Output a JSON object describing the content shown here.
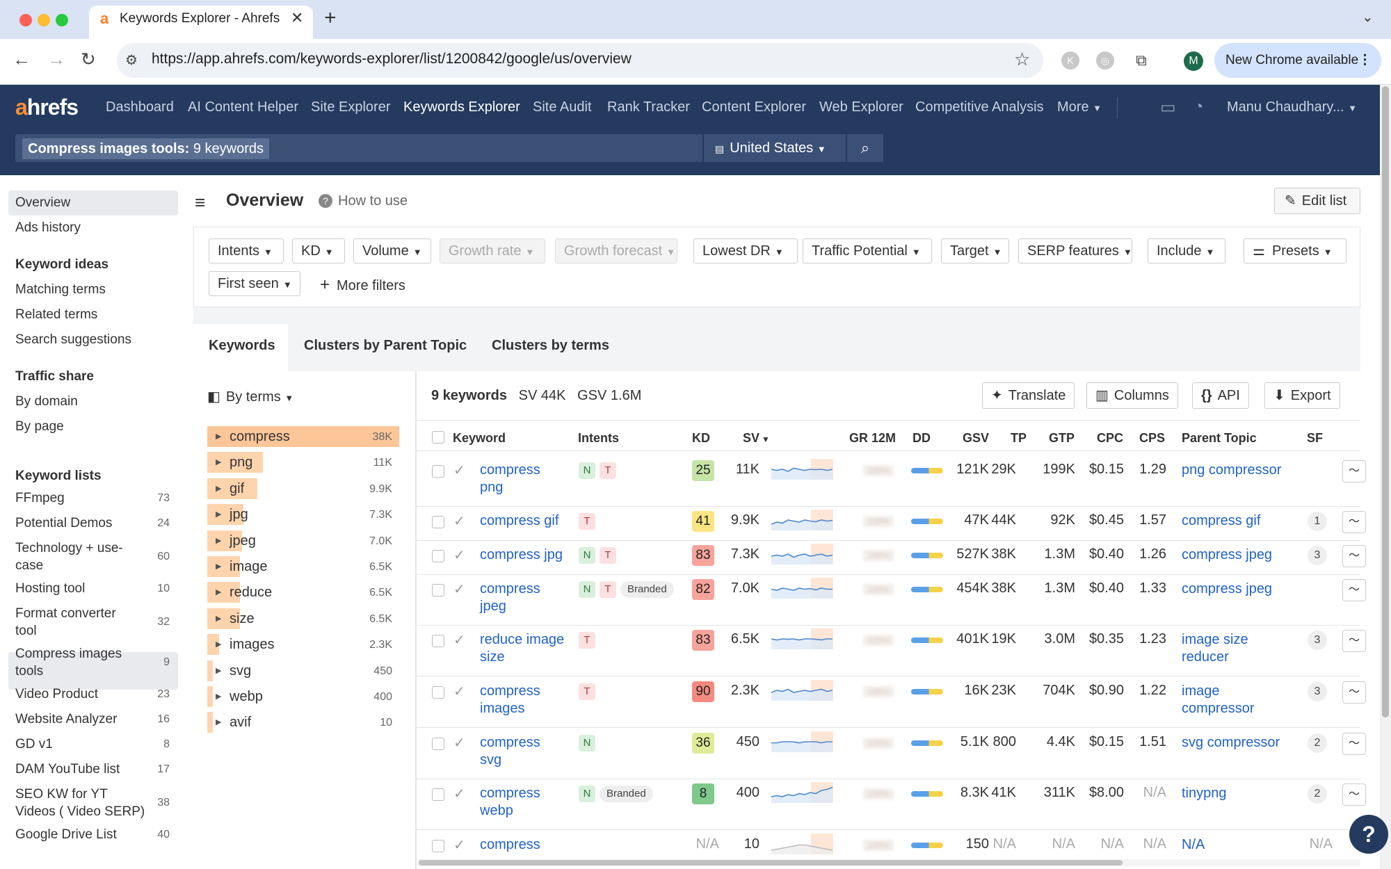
{
  "browser": {
    "tab_title": "Keywords Explorer - Ahrefs",
    "url": "https://app.ahrefs.com/keywords-explorer/list/1200842/google/us/overview",
    "new_chrome": "New Chrome available",
    "profile_initial": "M"
  },
  "nav": {
    "logo_a": "a",
    "logo_rest": "hrefs",
    "items": [
      "Dashboard",
      "AI Content Helper",
      "Site Explorer",
      "Keywords Explorer",
      "Site Audit",
      "Rank Tracker",
      "Content Explorer",
      "Web Explorer",
      "Competitive Analysis",
      "More"
    ],
    "user": "Manu Chaudhary..."
  },
  "search": {
    "list_name": "Compress images tools:",
    "list_count": "9 keywords",
    "country": "United States"
  },
  "sidebar": {
    "top": [
      "Overview",
      "Ads history"
    ],
    "keyword_ideas_heading": "Keyword ideas",
    "keyword_ideas": [
      "Matching terms",
      "Related terms",
      "Search suggestions"
    ],
    "traffic_share_heading": "Traffic share",
    "traffic_share": [
      "By domain",
      "By page"
    ],
    "keyword_lists_heading": "Keyword lists",
    "keyword_lists": [
      {
        "name1": "FFmpeg",
        "name2": "",
        "count": "73"
      },
      {
        "name1": "Potential Demos",
        "name2": "",
        "count": "24"
      },
      {
        "name1": "Technology + use-",
        "name2": "case",
        "count": "60"
      },
      {
        "name1": "Hosting tool",
        "name2": "",
        "count": "10"
      },
      {
        "name1": "Format converter",
        "name2": "tool",
        "count": "32"
      },
      {
        "name1": "Compress images",
        "name2": "tools",
        "count": "9"
      },
      {
        "name1": "Video Product",
        "name2": "",
        "count": "23"
      },
      {
        "name1": "Website Analyzer",
        "name2": "",
        "count": "16"
      },
      {
        "name1": "GD v1",
        "name2": "",
        "count": "8"
      },
      {
        "name1": "DAM YouTube list",
        "name2": "",
        "count": "17"
      },
      {
        "name1": "SEO KW for YT",
        "name2": "Videos ( Video SERP)",
        "count": "38"
      },
      {
        "name1": "Google Drive List",
        "name2": "",
        "count": "40"
      }
    ]
  },
  "header": {
    "title": "Overview",
    "how_to": "How to use",
    "edit_list": "Edit list"
  },
  "filters": {
    "row1": [
      "Intents",
      "KD",
      "Volume",
      "Growth rate",
      "Growth forecast",
      "Lowest DR",
      "Traffic Potential",
      "Target",
      "SERP features",
      "Include"
    ],
    "presets": "Presets",
    "row2": [
      "First seen"
    ],
    "more_filters": "More filters"
  },
  "tabs": [
    "Keywords",
    "Clusters by Parent Topic",
    "Clusters by terms"
  ],
  "clusters": {
    "group_by": "By terms",
    "items": [
      {
        "term": "compress",
        "count": "38K",
        "share": 1.0
      },
      {
        "term": "png",
        "count": "11K",
        "share": 0.29
      },
      {
        "term": "gif",
        "count": "9.9K",
        "share": 0.26
      },
      {
        "term": "jpg",
        "count": "7.3K",
        "share": 0.19
      },
      {
        "term": "jpeg",
        "count": "7.0K",
        "share": 0.18
      },
      {
        "term": "image",
        "count": "6.5K",
        "share": 0.17
      },
      {
        "term": "reduce",
        "count": "6.5K",
        "share": 0.17
      },
      {
        "term": "size",
        "count": "6.5K",
        "share": 0.17
      },
      {
        "term": "images",
        "count": "2.3K",
        "share": 0.06
      },
      {
        "term": "svg",
        "count": "450",
        "share": 0.012
      },
      {
        "term": "webp",
        "count": "400",
        "share": 0.011
      },
      {
        "term": "avif",
        "count": "10",
        "share": 0.0003
      }
    ]
  },
  "table": {
    "summary_count": "9 keywords",
    "summary_sv": "SV 44K",
    "summary_gsv": "GSV 1.6M",
    "buttons": [
      "Translate",
      "Columns",
      "API",
      "Export"
    ],
    "columns": [
      "Keyword",
      "Intents",
      "KD",
      "SV",
      "GR 12M",
      "DD",
      "GSV",
      "TP",
      "GTP",
      "CPC",
      "CPS",
      "Parent Topic",
      "SF"
    ],
    "gr_placeholder": "100%",
    "rows": [
      {
        "kw1": "compress",
        "kw2": "png",
        "intents": [
          "N",
          "T"
        ],
        "kd": "25",
        "kd_color": "#c5e4a5",
        "sv": "11K",
        "gsv": "121K",
        "tp": "29K",
        "gtp": "199K",
        "cpc": "$0.15",
        "cps": "1.29",
        "pt1": "png compressor",
        "pt2": "",
        "sf": "",
        "trend": [
          0.5,
          0.45,
          0.5,
          0.4,
          0.55,
          0.5,
          0.45,
          0.5,
          0.48,
          0.5,
          0.45,
          0.5
        ]
      },
      {
        "kw1": "compress gif",
        "kw2": "",
        "intents": [
          "T"
        ],
        "kd": "41",
        "kd_color": "#fbe482",
        "sv": "9.9K",
        "gsv": "47K",
        "tp": "44K",
        "gtp": "92K",
        "cpc": "$0.45",
        "cps": "1.57",
        "pt1": "compress gif",
        "pt2": "",
        "sf": "1",
        "trend": [
          0.3,
          0.4,
          0.35,
          0.5,
          0.45,
          0.4,
          0.5,
          0.45,
          0.42,
          0.5,
          0.45,
          0.48
        ]
      },
      {
        "kw1": "compress jpg",
        "kw2": "",
        "intents": [
          "N",
          "T"
        ],
        "kd": "83",
        "kd_color": "#f7a39b",
        "sv": "7.3K",
        "gsv": "527K",
        "tp": "38K",
        "gtp": "1.3M",
        "cpc": "$0.40",
        "cps": "1.26",
        "pt1": "compress jpeg",
        "pt2": "",
        "sf": "3",
        "trend": [
          0.4,
          0.45,
          0.4,
          0.5,
          0.35,
          0.45,
          0.5,
          0.4,
          0.45,
          0.5,
          0.4,
          0.45
        ]
      },
      {
        "kw1": "compress",
        "kw2": "jpeg",
        "intents": [
          "N",
          "T",
          "Branded"
        ],
        "kd": "82",
        "kd_color": "#f7a39b",
        "sv": "7.0K",
        "gsv": "454K",
        "tp": "38K",
        "gtp": "1.3M",
        "cpc": "$0.40",
        "cps": "1.33",
        "pt1": "compress jpeg",
        "pt2": "",
        "sf": "",
        "trend": [
          0.45,
          0.4,
          0.5,
          0.45,
          0.4,
          0.5,
          0.45,
          0.48,
          0.42,
          0.5,
          0.45,
          0.45
        ]
      },
      {
        "kw1": "reduce image",
        "kw2": "size",
        "intents": [
          "T"
        ],
        "kd": "83",
        "kd_color": "#f7a39b",
        "sv": "6.5K",
        "gsv": "401K",
        "tp": "19K",
        "gtp": "3.0M",
        "cpc": "$0.35",
        "cps": "1.23",
        "pt1": "image size",
        "pt2": "reducer",
        "sf": "3",
        "trend": [
          0.5,
          0.45,
          0.5,
          0.48,
          0.5,
          0.45,
          0.5,
          0.5,
          0.48,
          0.45,
          0.5,
          0.5
        ]
      },
      {
        "kw1": "compress",
        "kw2": "images",
        "intents": [
          "T"
        ],
        "kd": "90",
        "kd_color": "#f58a80",
        "sv": "2.3K",
        "gsv": "16K",
        "tp": "23K",
        "gtp": "704K",
        "cpc": "$0.90",
        "cps": "1.22",
        "pt1": "image",
        "pt2": "compressor",
        "sf": "3",
        "trend": [
          0.4,
          0.5,
          0.45,
          0.55,
          0.4,
          0.45,
          0.5,
          0.45,
          0.5,
          0.55,
          0.45,
          0.5
        ]
      },
      {
        "kw1": "compress",
        "kw2": "svg",
        "intents": [
          "N"
        ],
        "kd": "36",
        "kd_color": "#e0eb98",
        "sv": "450",
        "gsv": "5.1K",
        "tp": "800",
        "gtp": "4.4K",
        "cpc": "$0.15",
        "cps": "1.51",
        "pt1": "svg compressor",
        "pt2": "",
        "sf": "2",
        "trend": [
          0.45,
          0.45,
          0.5,
          0.5,
          0.5,
          0.45,
          0.5,
          0.5,
          0.5,
          0.45,
          0.5,
          0.5
        ]
      },
      {
        "kw1": "compress",
        "kw2": "webp",
        "intents": [
          "N",
          "Branded"
        ],
        "kd": "8",
        "kd_color": "#7fc98c",
        "sv": "400",
        "gsv": "8.3K",
        "tp": "41K",
        "gtp": "311K",
        "cpc": "$8.00",
        "cps": "N/A",
        "pt1": "tinypng",
        "pt2": "",
        "sf": "2",
        "trend": [
          0.3,
          0.35,
          0.3,
          0.4,
          0.35,
          0.45,
          0.4,
          0.5,
          0.45,
          0.6,
          0.65,
          0.75
        ]
      },
      {
        "kw1": "compress",
        "kw2": "",
        "intents": [],
        "kd": "N/A",
        "kd_color": "",
        "sv": "10",
        "gsv": "150",
        "tp": "N/A",
        "gtp": "N/A",
        "cpc": "N/A",
        "cps": "N/A",
        "pt1": "N/A",
        "pt2": "",
        "sf": "N/A",
        "trend": [
          0.2,
          0.25,
          0.3,
          0.35,
          0.4,
          0.45,
          0.45,
          0.4,
          0.35,
          0.3,
          0.25,
          0.2
        ]
      }
    ]
  }
}
